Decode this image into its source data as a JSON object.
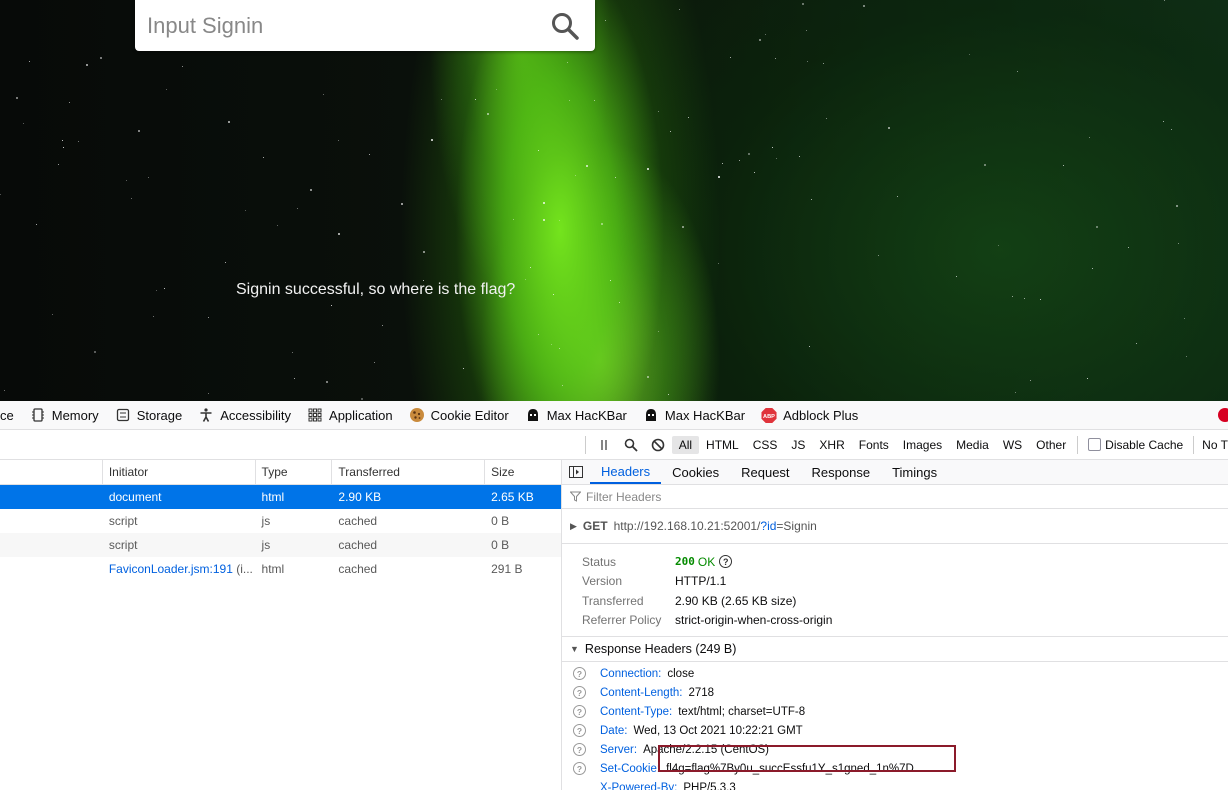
{
  "page": {
    "search_placeholder": "Input Signin",
    "message": "Signin successful, so where is the flag?"
  },
  "devtools": {
    "tool_tabs": [
      {
        "label": "ce",
        "icon": ""
      },
      {
        "label": "Memory",
        "icon": "memory-icon"
      },
      {
        "label": "Storage",
        "icon": "storage-icon"
      },
      {
        "label": "Accessibility",
        "icon": "accessibility-icon"
      },
      {
        "label": "Application",
        "icon": "application-grid-icon"
      },
      {
        "label": "Cookie Editor",
        "icon": "cookie-icon"
      },
      {
        "label": "Max HacKBar",
        "icon": "hackbar-icon"
      },
      {
        "label": "Max HacKBar",
        "icon": "hackbar-icon"
      },
      {
        "label": "Adblock Plus",
        "icon": "abp-icon"
      }
    ],
    "net_filters": [
      "All",
      "HTML",
      "CSS",
      "JS",
      "XHR",
      "Fonts",
      "Images",
      "Media",
      "WS",
      "Other"
    ],
    "active_filter": "All",
    "disable_cache_label": "Disable Cache",
    "throttle_label": "No T",
    "columns": [
      "",
      "Initiator",
      "Type",
      "Transferred",
      "Size"
    ],
    "requests": [
      {
        "initiator": "document",
        "type": "html",
        "transferred": "2.90 KB",
        "size": "2.65 KB",
        "selected": true
      },
      {
        "initiator": "script",
        "type": "js",
        "transferred": "cached",
        "size": "0 B",
        "selected": false
      },
      {
        "initiator": "script",
        "type": "js",
        "transferred": "cached",
        "size": "0 B",
        "selected": false
      },
      {
        "initiator": "FaviconLoader.jsm:191",
        "initiator_suffix": " (i...",
        "type": "html",
        "transferred": "cached",
        "size": "291 B",
        "selected": false
      }
    ],
    "detail_tabs": [
      "Headers",
      "Cookies",
      "Request",
      "Response",
      "Timings"
    ],
    "active_detail_tab": "Headers",
    "filter_headers_placeholder": "Filter Headers",
    "summary": {
      "method": "GET",
      "url_base": "http://192.168.10.21:52001/",
      "url_query_q": "?",
      "url_query_key": "id",
      "url_query_rest": "=Signin"
    },
    "status": {
      "status_label": "Status",
      "status_code": "200",
      "status_text": "OK",
      "version_label": "Version",
      "version": "HTTP/1.1",
      "transferred_label": "Transferred",
      "transferred": "2.90 KB (2.65 KB size)",
      "referrer_label": "Referrer Policy",
      "referrer": "strict-origin-when-cross-origin"
    },
    "response_headers_title": "Response Headers (249 B)",
    "response_headers": [
      {
        "name": "Connection:",
        "value": "close"
      },
      {
        "name": "Content-Length:",
        "value": "2718"
      },
      {
        "name": "Content-Type:",
        "value": "text/html; charset=UTF-8"
      },
      {
        "name": "Date:",
        "value": "Wed, 13 Oct 2021 10:22:21 GMT"
      },
      {
        "name": "Server:",
        "value": "Apache/2.2.15 (CentOS)"
      },
      {
        "name": "Set-Cookie:",
        "value": "fl4g=flag%7By0u_succEssfu1Y_s1gned_1n%7D"
      },
      {
        "name": "X-Powered-By:",
        "value": "PHP/5.3.3"
      }
    ]
  },
  "colors": {
    "accent": "#0060df",
    "selected_row": "#0074e8",
    "status_ok": "#058b00",
    "highlight_box": "#8b1a2a"
  }
}
